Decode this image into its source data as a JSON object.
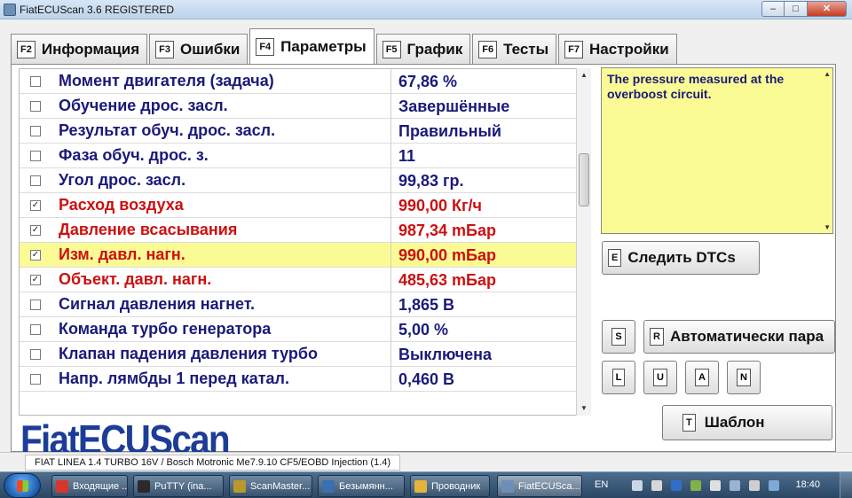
{
  "window": {
    "title": "FiatECUScan 3.6 REGISTERED",
    "buttons": {
      "min": "–",
      "max": "□",
      "close": "✕"
    }
  },
  "tabs": [
    {
      "key": "F2",
      "label": "Информация"
    },
    {
      "key": "F3",
      "label": "Ошибки"
    },
    {
      "key": "F4",
      "label": "Параметры"
    },
    {
      "key": "F5",
      "label": "График"
    },
    {
      "key": "F6",
      "label": "Тесты"
    },
    {
      "key": "F7",
      "label": "Настройки"
    }
  ],
  "active_tab": "Параметры",
  "parameters": [
    {
      "checked": false,
      "name": "Момент двигателя (задача)",
      "value": "67,86 %"
    },
    {
      "checked": false,
      "name": "Обучение дрос. засл.",
      "value": "Завершённые"
    },
    {
      "checked": false,
      "name": "Результат обуч. дрос. засл.",
      "value": "Правильный"
    },
    {
      "checked": false,
      "name": "Фаза обуч. дрос. з.",
      "value": "11"
    },
    {
      "checked": false,
      "name": "Угол дрос. засл.",
      "value": "99,83 гр."
    },
    {
      "checked": true,
      "name": "Расход воздуха",
      "value": "990,00 Кг/ч"
    },
    {
      "checked": true,
      "name": "Давление всасывания",
      "value": "987,34 mБар"
    },
    {
      "checked": true,
      "name": "Изм. давл. нагн.",
      "value": "990,00 mБар"
    },
    {
      "checked": true,
      "name": "Объект. давл. нагн.",
      "value": "485,63 mБар"
    },
    {
      "checked": false,
      "name": "Сигнал давления нагнет.",
      "value": "1,865 В"
    },
    {
      "checked": false,
      "name": "Команда турбо генератора",
      "value": "5,00 %"
    },
    {
      "checked": false,
      "name": "Клапан падения давления турбо",
      "value": "Выключена"
    },
    {
      "checked": false,
      "name": "Напр. лямбды 1 перед катал.",
      "value": "0,460 В"
    }
  ],
  "selected_row": "Изм. давл. нагн.",
  "description": "The pressure measured at the overboost circuit.",
  "buttons": {
    "follow_dtcs": {
      "key": "E",
      "label": "Следить DTCs"
    },
    "s": {
      "key": "S"
    },
    "auto": {
      "key": "R",
      "label": "Автоматически пара"
    },
    "l": {
      "key": "L"
    },
    "u": {
      "key": "U"
    },
    "a": {
      "key": "A"
    },
    "n": {
      "key": "N"
    },
    "template": {
      "key": "T",
      "label": "Шаблон"
    }
  },
  "logo": "FiatECUScan",
  "status": "FIAT LINEA 1.4 TURBO 16V / Bosch Motronic Me7.9.10 CF5/EOBD Injection (1.4)",
  "taskbar": {
    "items": [
      {
        "label": "Входящие ...",
        "icon_color": "#d7372a"
      },
      {
        "label": "PuTTY (ina...",
        "icon_color": "#2a2a2a"
      },
      {
        "label": "ScanMaster...",
        "icon_color": "#b89a2a"
      },
      {
        "label": "Безымянн...",
        "icon_color": "#3a6fb0"
      },
      {
        "label": "Проводник",
        "icon_color": "#e3b33d"
      },
      {
        "label": "FiatECUSca...",
        "icon_color": "#6d8fb5"
      }
    ],
    "language": "EN",
    "clock": "18:40"
  },
  "colors": {
    "accent_text": "#1a1a7a",
    "alert_text": "#cc1010",
    "highlight": "#fbfb95",
    "logo": "#1c3d97"
  }
}
